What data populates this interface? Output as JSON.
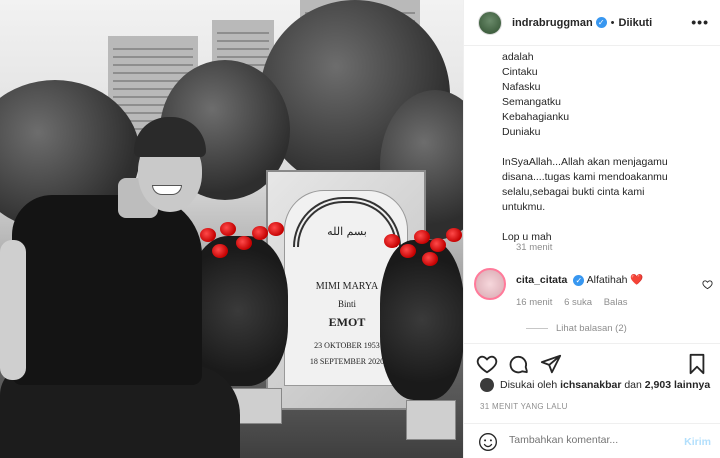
{
  "post": {
    "username": "indrabruggman",
    "follow_status": "Diikuti",
    "more_glyph": "•••",
    "verified_glyph": "✓",
    "caption_lines": [
      "adalah",
      "Cintaku",
      "Nafasku",
      "Semangatku",
      "Kebahagianku",
      "Duniaku"
    ],
    "caption_paragraph": [
      "InSyaAllah...Allah akan menjagamu",
      "disana....tugas kami mendoakanmu",
      "selalu,sebagai bukti cinta kami",
      "untukmu."
    ],
    "caption_sign": "Lop u mah",
    "caption_time": "31 menit"
  },
  "photo": {
    "stone_calligraphy": "بسم الله",
    "stone_name": "MIMI MARYA",
    "stone_binti": "Binti",
    "stone_father": "EMOT",
    "stone_birth": "23 OKTOBER 1953",
    "stone_death": "18 SEPTEMBER 2020"
  },
  "comment": {
    "username": "cita_citata",
    "text": "Alfatihah ❤️",
    "time": "16 menit",
    "likes": "6 suka",
    "reply": "Balas",
    "view_replies": "Lihat balasan (2)"
  },
  "likes": {
    "prefix": "Disukai oleh",
    "user": "ichsanakbar",
    "middle": "dan",
    "count": "2,903 lainnya"
  },
  "posted_ago": "31 MENIT YANG LALU",
  "add_comment": {
    "placeholder": "Tambahkan komentar...",
    "submit": "Kirim"
  },
  "colors": {
    "verified": "#3897f0",
    "kirim": "#b2dffc",
    "rose": "#d40000"
  },
  "icons": [
    "heart-icon",
    "comment-icon",
    "share-icon",
    "bookmark-icon",
    "emoji-icon",
    "verified-icon",
    "more-icon"
  ]
}
